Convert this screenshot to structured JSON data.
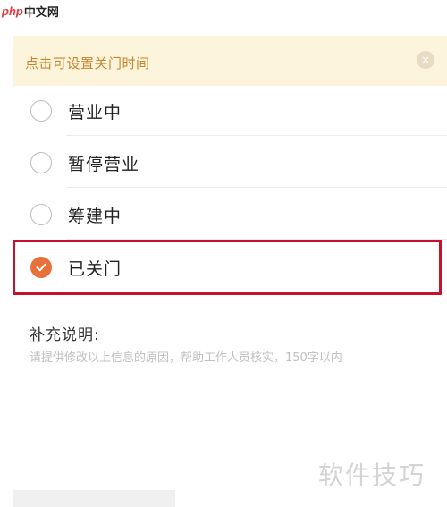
{
  "site_logo": {
    "php": "php",
    "cn": "中文网"
  },
  "banner": {
    "text": "点击可设置关门时间",
    "close_glyph": "×"
  },
  "options": [
    {
      "label": "营业中",
      "checked": false
    },
    {
      "label": "暂停营业",
      "checked": false
    },
    {
      "label": "筹建中",
      "checked": false
    },
    {
      "label": "已关门",
      "checked": true
    }
  ],
  "note": {
    "title": "补充说明:",
    "placeholder": "请提供修改以上信息的原因，帮助工作人员核实，150字以内",
    "value": ""
  },
  "watermark": "软件技巧",
  "colors": {
    "accent": "#e8713a",
    "highlight_frame": "#c8102e",
    "banner_bg": "#fdf4dc",
    "banner_text": "#c9852e"
  }
}
